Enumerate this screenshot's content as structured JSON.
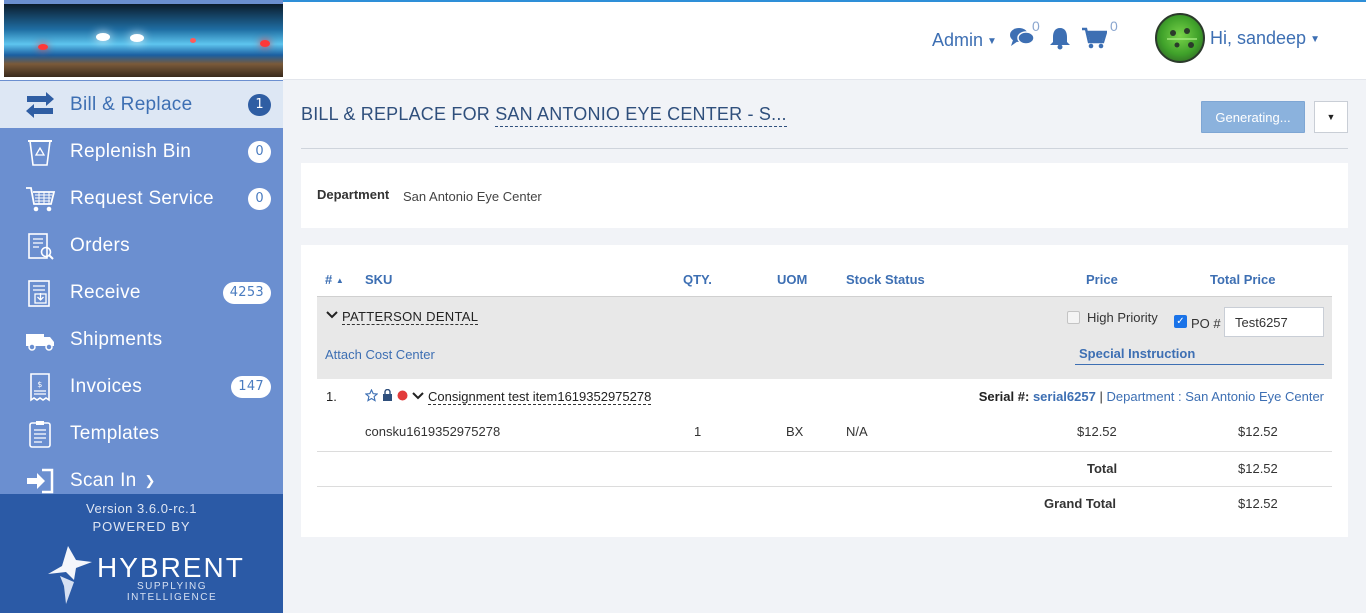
{
  "header": {
    "admin_label": "Admin",
    "messages_count": "0",
    "cart_count": "0",
    "user_greeting": "Hi, sandeep"
  },
  "sidebar": {
    "items": [
      {
        "label": "Bill & Replace",
        "badge": "1",
        "icon": "swap-icon"
      },
      {
        "label": "Replenish Bin",
        "badge": "0",
        "icon": "recycle-bin-icon"
      },
      {
        "label": "Request Service",
        "badge": "0",
        "icon": "cart-service-icon"
      },
      {
        "label": "Orders",
        "icon": "orders-icon"
      },
      {
        "label": "Receive",
        "badge": "4253",
        "icon": "receive-icon"
      },
      {
        "label": "Shipments",
        "icon": "truck-icon"
      },
      {
        "label": "Invoices",
        "badge": "147",
        "icon": "invoice-icon"
      },
      {
        "label": "Templates",
        "icon": "clipboard-icon"
      },
      {
        "label": "Scan In",
        "icon": "sign-in-icon"
      }
    ],
    "version": "Version 3.6.0-rc.1",
    "powered_by": "POWERED BY",
    "brand": "HYBRENT",
    "brand_tagline": "SUPPLYING INTELLIGENCE"
  },
  "main": {
    "title_prefix": "BILL & REPLACE FOR",
    "title_dept": "SAN ANTONIO EYE CENTER - S...",
    "generating_label": "Generating...",
    "department_label": "Department",
    "department_value": "San Antonio Eye Center",
    "columns": {
      "num": "#",
      "sku": "SKU",
      "qty": "QTY.",
      "uom": "UOM",
      "stock": "Stock Status",
      "price": "Price",
      "total_price": "Total Price"
    },
    "vendor": {
      "name": "PATTERSON DENTAL",
      "attach_cost_center": "Attach Cost Center",
      "high_priority": "High Priority",
      "po_label": "PO #",
      "po_value": "Test6257",
      "special_instruction": "Special Instruction"
    },
    "item": {
      "num": "1.",
      "name": "Consignment test item1619352975278",
      "serial_label": "Serial #:",
      "serial_value": "serial6257",
      "separator": "|",
      "department_ref": "Department : San Antonio Eye Center",
      "sku": "consku1619352975278",
      "qty": "1",
      "uom": "BX",
      "stock_status": "N/A",
      "price": "$12.52",
      "total_price": "$12.52"
    },
    "total_label": "Total",
    "total_value": "$12.52",
    "grand_total_label": "Grand Total",
    "grand_total_value": "$12.52"
  },
  "colors": {
    "sidebar_bg": "#6b8fd0",
    "sidebar_footer": "#2b5aa6",
    "accent": "#3d6fb3",
    "active_item_bg": "#dde7f4"
  }
}
